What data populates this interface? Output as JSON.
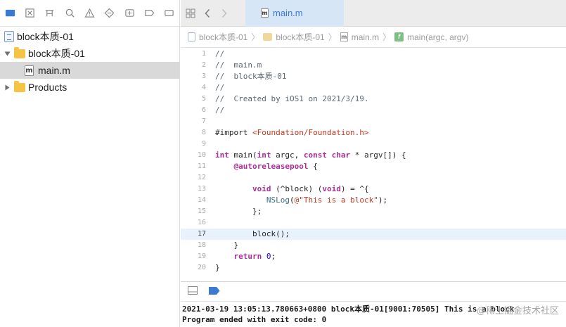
{
  "navigator": {
    "toolbar_icons": [
      "project-navigator-icon",
      "source-control-icon",
      "symbol-navigator-icon",
      "find-icon",
      "issue-icon",
      "test-icon",
      "debug-icon",
      "breakpoint-icon",
      "report-icon"
    ],
    "items": [
      {
        "label": "block本质-01",
        "icon": "project-file-icon",
        "indent": 0
      },
      {
        "label": "block本质-01",
        "icon": "folder-icon",
        "indent": 1,
        "expanded": true
      },
      {
        "label": "main.m",
        "icon": "m-file-icon",
        "indent": 2,
        "selected": true
      },
      {
        "label": "Products",
        "icon": "folder-icon",
        "indent": 1,
        "expanded": false
      }
    ]
  },
  "editor": {
    "tab_label": "main.m",
    "jump_bar": [
      "block本质-01",
      "block本质-01",
      "main.m",
      "main(argc, argv)"
    ],
    "current_line": 17,
    "lines": [
      {
        "n": "1",
        "text": "//"
      },
      {
        "n": "2",
        "text": "//  main.m"
      },
      {
        "n": "3",
        "text": "//  block本质-01"
      },
      {
        "n": "4",
        "text": "//"
      },
      {
        "n": "5",
        "text": "//  Created by iOS1 on 2021/3/19."
      },
      {
        "n": "6",
        "text": "//"
      },
      {
        "n": "7",
        "text": ""
      },
      {
        "n": "8",
        "text": "#import <Foundation/Foundation.h>"
      },
      {
        "n": "9",
        "text": ""
      },
      {
        "n": "10",
        "text": "int main(int argc, const char * argv[]) {"
      },
      {
        "n": "11",
        "text": "    @autoreleasepool {"
      },
      {
        "n": "12",
        "text": ""
      },
      {
        "n": "13",
        "text": "        void (^block) (void) = ^{"
      },
      {
        "n": "14",
        "text": "           NSLog(@\"This is a block\");"
      },
      {
        "n": "15",
        "text": "        };"
      },
      {
        "n": "16",
        "text": ""
      },
      {
        "n": "17",
        "text": "        block();"
      },
      {
        "n": "18",
        "text": "    }"
      },
      {
        "n": "19",
        "text": "    return 0;"
      },
      {
        "n": "20",
        "text": "}"
      }
    ]
  },
  "console": {
    "line1": "2021-03-19 13:05:13.780663+0800 block本质-01[9001:70505] This is a block",
    "line2": "Program ended with exit code: 0",
    "watermark": "@稀土掘金技术社区"
  },
  "colors": {
    "accent": "#3a7ad5",
    "keyword": "#a9309a",
    "string": "#c4371e",
    "comment": "#5c6770",
    "current_line": "#e8f2fd",
    "folder": "#f6c343"
  }
}
